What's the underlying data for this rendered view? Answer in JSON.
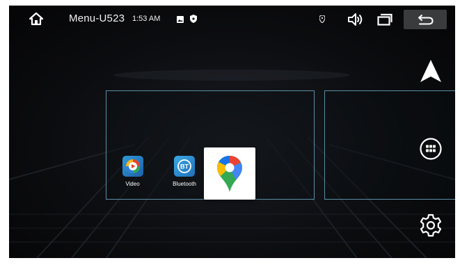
{
  "status_bar": {
    "home_icon": "home-icon",
    "title": "Menu-U523",
    "time": "1:53 AM",
    "indicators": [
      "photo-icon",
      "shield-icon"
    ],
    "location_icon": "location-pin-icon",
    "volume_icon": "volume-icon",
    "recents_icon": "recents-icon",
    "back_icon": "back-arrow-icon"
  },
  "apps": [
    {
      "label": "Video",
      "icon": "video-icon"
    },
    {
      "label": "Bluetooth",
      "icon": "bluetooth-icon",
      "icon_text": "BT"
    },
    {
      "label": "",
      "icon": "google-maps-icon",
      "focused": true
    }
  ],
  "side_controls": [
    {
      "icon": "navigation-arrow-icon"
    },
    {
      "icon": "app-grid-icon"
    },
    {
      "icon": "settings-gear-icon"
    }
  ],
  "colors": {
    "panel_border": "#5b8fa6",
    "back_button": "#3a3b3d"
  }
}
